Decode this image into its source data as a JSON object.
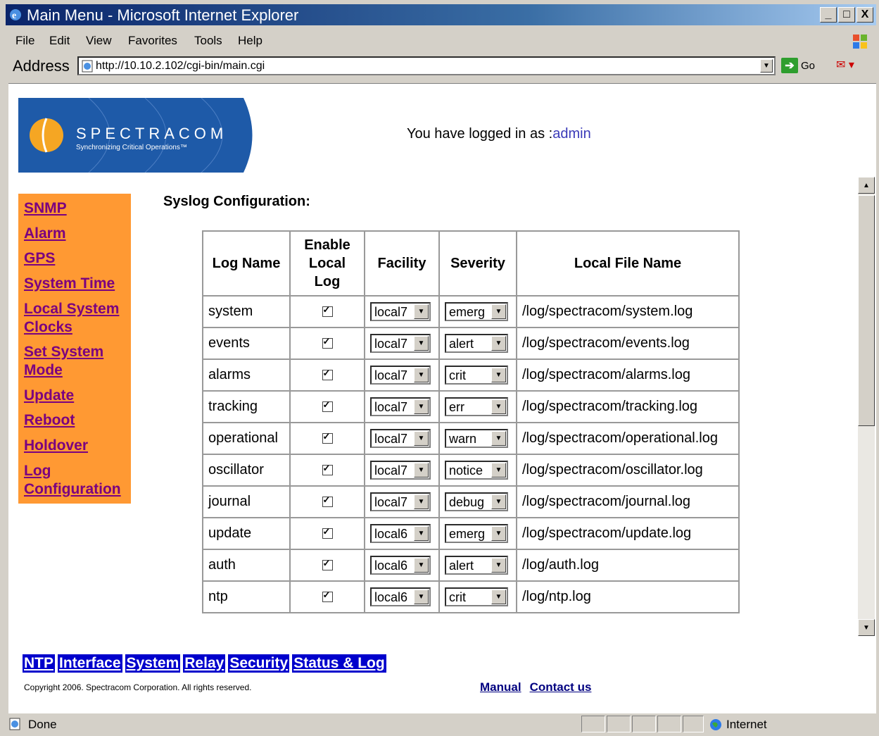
{
  "window": {
    "title": "Main Menu - Microsoft Internet Explorer",
    "buttons": [
      "_",
      "□",
      "X"
    ]
  },
  "menubar": {
    "items": [
      "File",
      "Edit",
      "View",
      "Favorites",
      "Tools",
      "Help"
    ]
  },
  "address": {
    "label": "Address",
    "url": "http://10.10.2.102/cgi-bin/main.cgi",
    "go_label": "Go"
  },
  "logo": {
    "brand": "SPECTRACOM",
    "tagline": "Synchronizing Critical Operations™"
  },
  "login": {
    "prefix": "You have logged in as :",
    "user": "admin"
  },
  "leftnav": {
    "items": [
      "SNMP",
      "Alarm",
      "GPS",
      "System Time",
      "Local System Clocks",
      "Set System Mode",
      "Update",
      "Reboot",
      "Holdover",
      "Log Configuration"
    ]
  },
  "section_title": "Syslog Configuration:",
  "table": {
    "headers": [
      "Log Name",
      "Enable Local Log",
      "Facility",
      "Severity",
      "Local File Name"
    ],
    "rows": [
      {
        "name": "system",
        "enabled": true,
        "facility": "local7",
        "severity": "emerg",
        "file": "/log/spectracom/system.log"
      },
      {
        "name": "events",
        "enabled": true,
        "facility": "local7",
        "severity": "alert",
        "file": "/log/spectracom/events.log"
      },
      {
        "name": "alarms",
        "enabled": true,
        "facility": "local7",
        "severity": "crit",
        "file": "/log/spectracom/alarms.log"
      },
      {
        "name": "tracking",
        "enabled": true,
        "facility": "local7",
        "severity": "err",
        "file": "/log/spectracom/tracking.log"
      },
      {
        "name": "operational",
        "enabled": true,
        "facility": "local7",
        "severity": "warn",
        "file": "/log/spectracom/operational.log"
      },
      {
        "name": "oscillator",
        "enabled": true,
        "facility": "local7",
        "severity": "notice",
        "file": "/log/spectracom/oscillator.log"
      },
      {
        "name": "journal",
        "enabled": true,
        "facility": "local7",
        "severity": "debug",
        "file": "/log/spectracom/journal.log"
      },
      {
        "name": "update",
        "enabled": true,
        "facility": "local6",
        "severity": "emerg",
        "file": "/log/spectracom/update.log"
      },
      {
        "name": "auth",
        "enabled": true,
        "facility": "local6",
        "severity": "alert",
        "file": "/log/auth.log"
      },
      {
        "name": "ntp",
        "enabled": true,
        "facility": "local6",
        "severity": "crit",
        "file": "/log/ntp.log"
      }
    ]
  },
  "bottom_nav": {
    "items": [
      "NTP",
      "Interface",
      "System",
      "Relay",
      "Security",
      "Status & Log"
    ]
  },
  "footer": {
    "copyright": "Copyright 2006. Spectracom Corporation. All rights reserved.",
    "links": [
      "Manual",
      "Contact us"
    ]
  },
  "status": {
    "text": "Done",
    "zone": "Internet"
  },
  "colors": {
    "nav_bg": "#ff9933",
    "nav_link": "#7a0080",
    "bottom_nav_bg": "#0000cc",
    "logo_bg": "#1e5aa8"
  }
}
